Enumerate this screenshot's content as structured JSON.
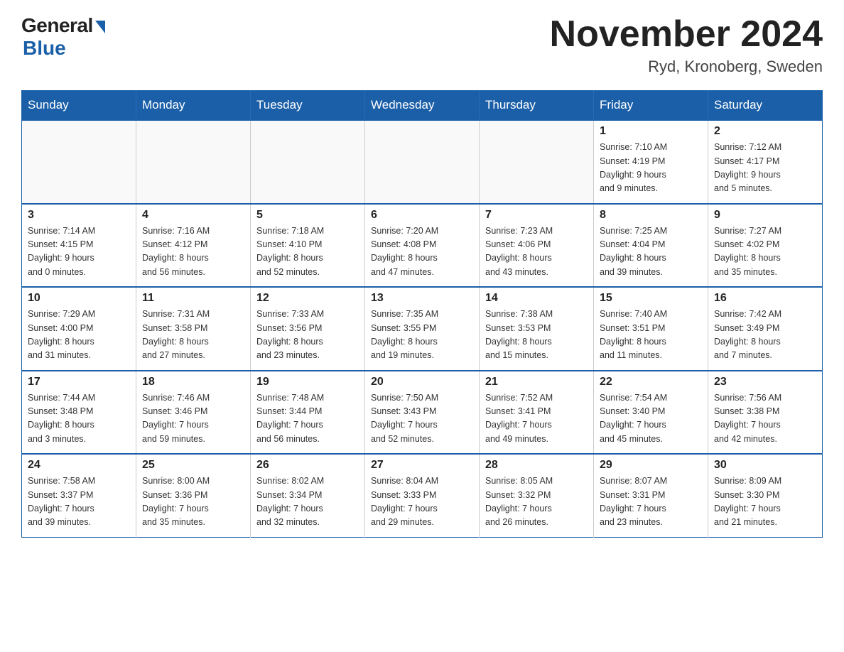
{
  "header": {
    "logo": {
      "general": "General",
      "blue": "Blue"
    },
    "title": "November 2024",
    "location": "Ryd, Kronoberg, Sweden"
  },
  "days_of_week": [
    "Sunday",
    "Monday",
    "Tuesday",
    "Wednesday",
    "Thursday",
    "Friday",
    "Saturday"
  ],
  "weeks": [
    [
      {
        "day": "",
        "info": ""
      },
      {
        "day": "",
        "info": ""
      },
      {
        "day": "",
        "info": ""
      },
      {
        "day": "",
        "info": ""
      },
      {
        "day": "",
        "info": ""
      },
      {
        "day": "1",
        "info": "Sunrise: 7:10 AM\nSunset: 4:19 PM\nDaylight: 9 hours\nand 9 minutes."
      },
      {
        "day": "2",
        "info": "Sunrise: 7:12 AM\nSunset: 4:17 PM\nDaylight: 9 hours\nand 5 minutes."
      }
    ],
    [
      {
        "day": "3",
        "info": "Sunrise: 7:14 AM\nSunset: 4:15 PM\nDaylight: 9 hours\nand 0 minutes."
      },
      {
        "day": "4",
        "info": "Sunrise: 7:16 AM\nSunset: 4:12 PM\nDaylight: 8 hours\nand 56 minutes."
      },
      {
        "day": "5",
        "info": "Sunrise: 7:18 AM\nSunset: 4:10 PM\nDaylight: 8 hours\nand 52 minutes."
      },
      {
        "day": "6",
        "info": "Sunrise: 7:20 AM\nSunset: 4:08 PM\nDaylight: 8 hours\nand 47 minutes."
      },
      {
        "day": "7",
        "info": "Sunrise: 7:23 AM\nSunset: 4:06 PM\nDaylight: 8 hours\nand 43 minutes."
      },
      {
        "day": "8",
        "info": "Sunrise: 7:25 AM\nSunset: 4:04 PM\nDaylight: 8 hours\nand 39 minutes."
      },
      {
        "day": "9",
        "info": "Sunrise: 7:27 AM\nSunset: 4:02 PM\nDaylight: 8 hours\nand 35 minutes."
      }
    ],
    [
      {
        "day": "10",
        "info": "Sunrise: 7:29 AM\nSunset: 4:00 PM\nDaylight: 8 hours\nand 31 minutes."
      },
      {
        "day": "11",
        "info": "Sunrise: 7:31 AM\nSunset: 3:58 PM\nDaylight: 8 hours\nand 27 minutes."
      },
      {
        "day": "12",
        "info": "Sunrise: 7:33 AM\nSunset: 3:56 PM\nDaylight: 8 hours\nand 23 minutes."
      },
      {
        "day": "13",
        "info": "Sunrise: 7:35 AM\nSunset: 3:55 PM\nDaylight: 8 hours\nand 19 minutes."
      },
      {
        "day": "14",
        "info": "Sunrise: 7:38 AM\nSunset: 3:53 PM\nDaylight: 8 hours\nand 15 minutes."
      },
      {
        "day": "15",
        "info": "Sunrise: 7:40 AM\nSunset: 3:51 PM\nDaylight: 8 hours\nand 11 minutes."
      },
      {
        "day": "16",
        "info": "Sunrise: 7:42 AM\nSunset: 3:49 PM\nDaylight: 8 hours\nand 7 minutes."
      }
    ],
    [
      {
        "day": "17",
        "info": "Sunrise: 7:44 AM\nSunset: 3:48 PM\nDaylight: 8 hours\nand 3 minutes."
      },
      {
        "day": "18",
        "info": "Sunrise: 7:46 AM\nSunset: 3:46 PM\nDaylight: 7 hours\nand 59 minutes."
      },
      {
        "day": "19",
        "info": "Sunrise: 7:48 AM\nSunset: 3:44 PM\nDaylight: 7 hours\nand 56 minutes."
      },
      {
        "day": "20",
        "info": "Sunrise: 7:50 AM\nSunset: 3:43 PM\nDaylight: 7 hours\nand 52 minutes."
      },
      {
        "day": "21",
        "info": "Sunrise: 7:52 AM\nSunset: 3:41 PM\nDaylight: 7 hours\nand 49 minutes."
      },
      {
        "day": "22",
        "info": "Sunrise: 7:54 AM\nSunset: 3:40 PM\nDaylight: 7 hours\nand 45 minutes."
      },
      {
        "day": "23",
        "info": "Sunrise: 7:56 AM\nSunset: 3:38 PM\nDaylight: 7 hours\nand 42 minutes."
      }
    ],
    [
      {
        "day": "24",
        "info": "Sunrise: 7:58 AM\nSunset: 3:37 PM\nDaylight: 7 hours\nand 39 minutes."
      },
      {
        "day": "25",
        "info": "Sunrise: 8:00 AM\nSunset: 3:36 PM\nDaylight: 7 hours\nand 35 minutes."
      },
      {
        "day": "26",
        "info": "Sunrise: 8:02 AM\nSunset: 3:34 PM\nDaylight: 7 hours\nand 32 minutes."
      },
      {
        "day": "27",
        "info": "Sunrise: 8:04 AM\nSunset: 3:33 PM\nDaylight: 7 hours\nand 29 minutes."
      },
      {
        "day": "28",
        "info": "Sunrise: 8:05 AM\nSunset: 3:32 PM\nDaylight: 7 hours\nand 26 minutes."
      },
      {
        "day": "29",
        "info": "Sunrise: 8:07 AM\nSunset: 3:31 PM\nDaylight: 7 hours\nand 23 minutes."
      },
      {
        "day": "30",
        "info": "Sunrise: 8:09 AM\nSunset: 3:30 PM\nDaylight: 7 hours\nand 21 minutes."
      }
    ]
  ]
}
